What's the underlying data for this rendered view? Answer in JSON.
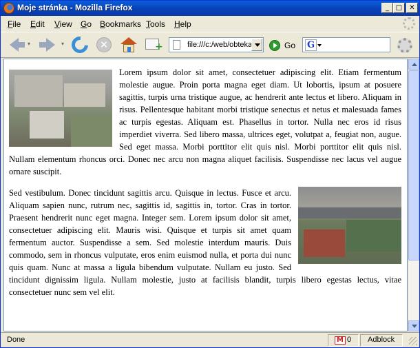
{
  "window": {
    "title": "Moje stránka - Mozilla Firefox",
    "minimize_glyph": "_",
    "maximize_glyph": "□",
    "close_glyph": "✕"
  },
  "menu": {
    "items": [
      {
        "acc": "F",
        "rest": "ile"
      },
      {
        "acc": "E",
        "rest": "dit"
      },
      {
        "acc": "V",
        "rest": "iew"
      },
      {
        "acc": "G",
        "rest": "o"
      },
      {
        "acc": "B",
        "rest": "ookmarks"
      },
      {
        "acc": "T",
        "rest": "ools"
      },
      {
        "acc": "H",
        "rest": "elp"
      }
    ]
  },
  "toolbar": {
    "url": "file:///c:/web/obtekani.html",
    "go_label": "Go",
    "search_engine_letter": "G",
    "search_value": "",
    "stop_glyph": "×",
    "add_glyph": "+",
    "drop_glyph": "▾"
  },
  "content": {
    "paragraph1": "Lorem ipsum dolor sit amet, consectetuer adipiscing elit. Etiam fermentum molestie augue. Proin porta magna eget diam. Ut lobortis, ipsum at posuere sagittis, turpis urna tristique augue, ac hendrerit ante lectus et libero. Aliquam in risus. Pellentesque habitant morbi tristique senectus et netus et malesuada fames ac turpis egestas. Aliquam est. Phasellus in tortor. Nulla nec eros id risus imperdiet viverra. Sed libero massa, ultrices eget, volutpat a, feugiat non, augue. Sed eget massa. Morbi porttitor elit quis nisl. Morbi porttitor elit quis nisl. Nullam elementum rhoncus orci. Donec nec arcu non magna aliquet facilisis. Suspendisse nec lacus vel augue ornare suscipit.",
    "paragraph2": "Sed vestibulum. Donec tincidunt sagittis arcu. Quisque in lectus. Fusce et arcu. Aliquam sapien nunc, rutrum nec, sagittis id, sagittis in, tortor. Cras in tortor. Praesent hendrerit nunc eget magna. Integer sem. Lorem ipsum dolor sit amet, consectetuer adipiscing elit. Mauris wisi. Quisque et turpis sit amet quam fermentum auctor. Suspendisse a sem. Sed molestie interdum mauris. Duis commodo, sem in rhoncus vulputate, eros enim euismod nulla, et porta dui nunc quis quam. Nunc at massa a ligula bibendum vulputate. Nullam eu justo. Sed tincidunt dignissim ligula. Nullam molestie, justo at facilisis blandit, turpis libero egestas lectus, vitae consectetuer nunc sem vel elit."
  },
  "status": {
    "text": "Done",
    "mail_icon_letter": "M",
    "mail_count": "0",
    "adblock_label": "Adblock"
  },
  "colors": {
    "titlebar": "#0a5fd8",
    "chrome": "#ece9d8",
    "page_background": "#ffffff"
  }
}
